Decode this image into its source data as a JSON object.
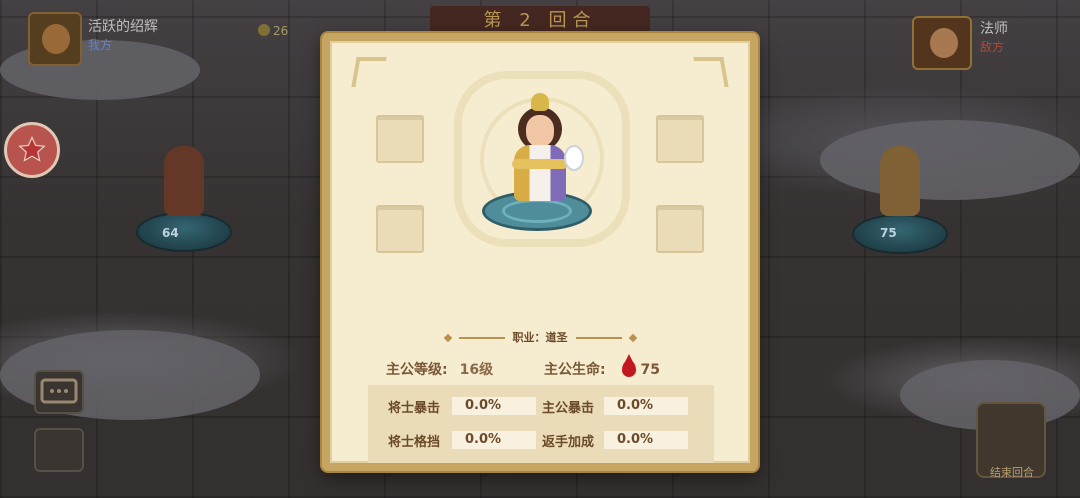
{
  "hud": {
    "player_name": "活跃的绍辉",
    "player_side": "我方",
    "coins": "26",
    "round_banner": "第 2 回合",
    "enemy_name": "法师",
    "enemy_side": "敌方",
    "end_turn_label": "结束回合"
  },
  "battlefield": {
    "ally_unit_hp": "64",
    "enemy_unit_hp": "75"
  },
  "hero_panel": {
    "class_label": "职业：道圣",
    "lord_level_label": "主公等级:",
    "lord_level_value": "16级",
    "lord_hp_label": "主公生命:",
    "lord_hp_value": "75",
    "stats": [
      {
        "label": "将士暴击",
        "value": "0.0%"
      },
      {
        "label": "主公暴击",
        "value": "0.0%"
      },
      {
        "label": "将士格挡",
        "value": "0.0%"
      },
      {
        "label": "返手加成",
        "value": "0.0%"
      }
    ],
    "hp_icon_color": "#c21820"
  },
  "colors": {
    "panel_border": "#c5a561",
    "panel_bg": "#f6ecd0",
    "text_brown": "#6b4a2a"
  }
}
